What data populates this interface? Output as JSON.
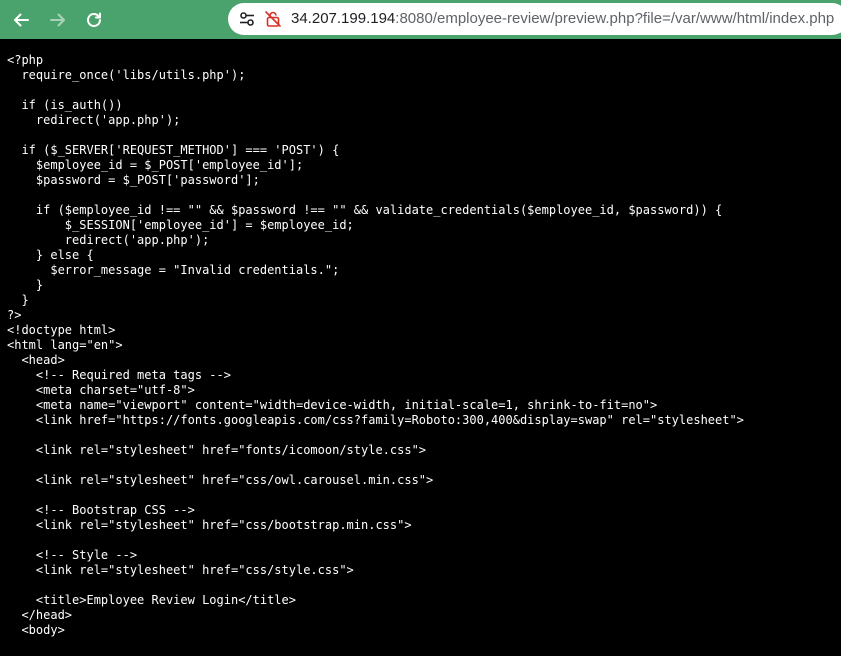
{
  "browser": {
    "url_host": "34.207.199.194",
    "url_rest": ":8080/employee-review/preview.php?file=/var/www/html/index.php",
    "toolbar_color": "#4aa36c",
    "icons": {
      "back": "arrow-left-icon",
      "forward": "arrow-right-icon",
      "reload": "reload-icon",
      "site_info": "tune-icon",
      "security": "not-secure-icon"
    }
  },
  "code_lines": [
    "<?php",
    "  require_once('libs/utils.php');",
    "",
    "  if (is_auth())",
    "    redirect('app.php');",
    "",
    "  if ($_SERVER['REQUEST_METHOD'] === 'POST') {",
    "    $employee_id = $_POST['employee_id'];",
    "    $password = $_POST['password'];",
    "",
    "    if ($employee_id !== \"\" && $password !== \"\" && validate_credentials($employee_id, $password)) {",
    "        $_SESSION['employee_id'] = $employee_id;",
    "        redirect('app.php');",
    "    } else {",
    "      $error_message = \"Invalid credentials.\";",
    "    }",
    "  }",
    "?>",
    "<!doctype html>",
    "<html lang=\"en\">",
    "  <head>",
    "    <!-- Required meta tags -->",
    "    <meta charset=\"utf-8\">",
    "    <meta name=\"viewport\" content=\"width=device-width, initial-scale=1, shrink-to-fit=no\">",
    "    <link href=\"https://fonts.googleapis.com/css?family=Roboto:300,400&display=swap\" rel=\"stylesheet\">",
    "",
    "    <link rel=\"stylesheet\" href=\"fonts/icomoon/style.css\">",
    "",
    "    <link rel=\"stylesheet\" href=\"css/owl.carousel.min.css\">",
    "",
    "    <!-- Bootstrap CSS -->",
    "    <link rel=\"stylesheet\" href=\"css/bootstrap.min.css\">",
    "",
    "    <!-- Style -->",
    "    <link rel=\"stylesheet\" href=\"css/style.css\">",
    "",
    "    <title>Employee Review Login</title>",
    "  </head>",
    "  <body>"
  ]
}
